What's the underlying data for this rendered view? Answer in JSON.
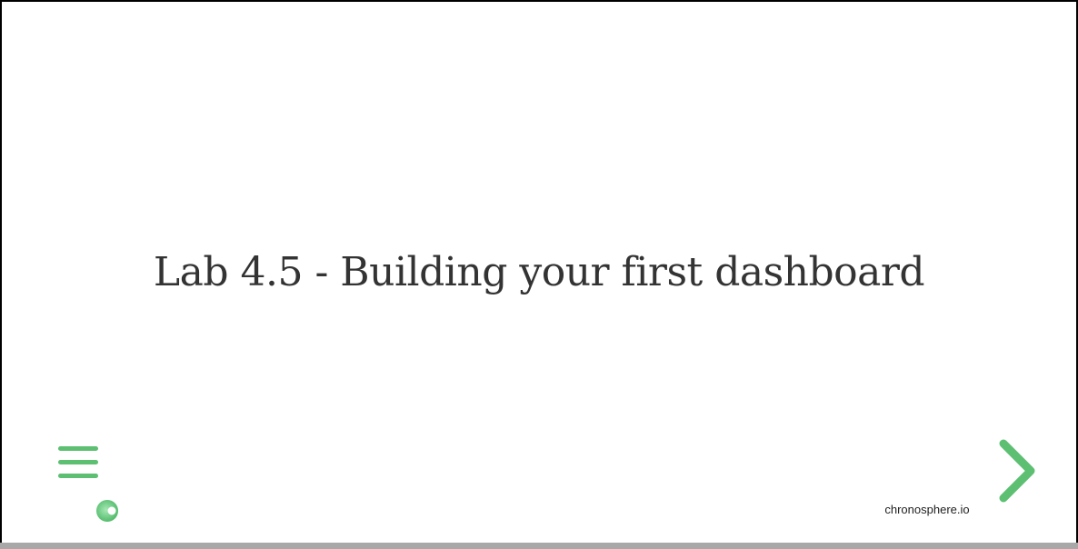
{
  "slide": {
    "title": "Lab 4.5 - Building your first dashboard"
  },
  "footer": {
    "site_label": "chronosphere.io"
  },
  "icons": {
    "menu": "hamburger-menu-icon",
    "logo": "chronosphere-logo-icon",
    "next": "chevron-right-icon"
  },
  "colors": {
    "accent": "#5cbf72",
    "title_text": "#333333",
    "progress_track": "#a8a8a8"
  }
}
